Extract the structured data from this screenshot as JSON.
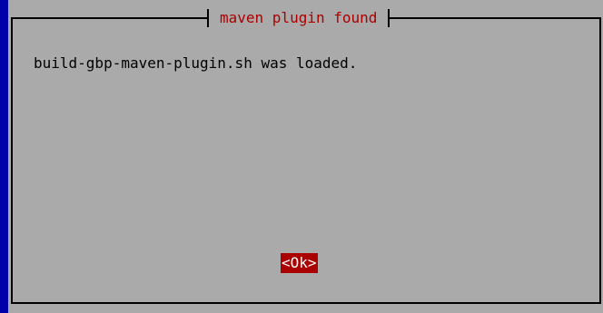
{
  "dialog": {
    "title": "maven plugin found",
    "message": "build-gbp-maven-plugin.sh was loaded.",
    "ok_label": "<Ok>"
  },
  "colors": {
    "background": "#0000aa",
    "dialog": "#aaaaaa",
    "title_text": "#aa0000",
    "button_bg": "#aa0000",
    "button_text": "#ffffff"
  }
}
